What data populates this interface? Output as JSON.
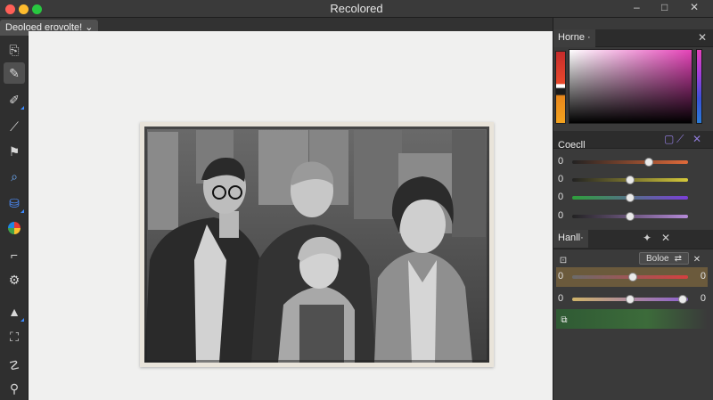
{
  "window": {
    "title": "Recolored",
    "controls": {
      "minimize": "–",
      "maximize": "□",
      "close": "✕"
    }
  },
  "document_tab": {
    "label": "Deoloed erovolte! ⌄"
  },
  "tools": [
    {
      "name": "document-icon",
      "glyph": "⎘"
    },
    {
      "name": "brush-icon",
      "glyph": "✎"
    },
    {
      "name": "eraser-icon",
      "glyph": "✐"
    },
    {
      "name": "dropper-icon",
      "glyph": "⟋"
    },
    {
      "name": "flag-icon",
      "glyph": "⚑"
    },
    {
      "name": "magnify-icon",
      "glyph": "⌕"
    },
    {
      "name": "paint-bucket-icon",
      "glyph": "⛁"
    },
    {
      "name": "color-wheel-icon",
      "glyph": "◕"
    },
    {
      "name": "crop-icon",
      "glyph": "⌐"
    },
    {
      "name": "gear-icon",
      "glyph": "⚙"
    },
    {
      "name": "triangle-icon",
      "glyph": "▲"
    },
    {
      "name": "transform-icon",
      "glyph": "⛶"
    },
    {
      "name": "lasso-icon",
      "glyph": "☡"
    },
    {
      "name": "zoom-icon",
      "glyph": "⚲"
    }
  ],
  "panels": {
    "color": {
      "title": "Horne ·",
      "close": "✕"
    },
    "channels": {
      "title": "Coecll",
      "actions": [
        "▢",
        "⟋",
        "✕"
      ],
      "sliders": [
        {
          "value": "0",
          "level": 0.66,
          "colors": [
            "#222222",
            "#e06a3a"
          ]
        },
        {
          "value": "0",
          "level": 0.5,
          "colors": [
            "#222222",
            "#d4c83a"
          ]
        },
        {
          "value": "0",
          "level": 0.5,
          "colors": [
            "#2ea03b",
            "#7b3fd8"
          ]
        },
        {
          "value": "0",
          "level": 0.5,
          "colors": [
            "#222222",
            "#b58ad8"
          ]
        }
      ]
    },
    "hsl": {
      "title": "Hanll·",
      "actions": [
        "✦",
        "✕"
      ],
      "lock_icon": "⊡",
      "mode_button": "Boloe",
      "mode_extra": "⇄",
      "mode_close": "✕",
      "sliders": [
        {
          "value_left": "0",
          "value_right": "0",
          "level": 0.52,
          "colors": [
            "#6b6b6b",
            "#d44040"
          ]
        },
        {
          "value_left": "0",
          "value_right": "0",
          "level": 0.5,
          "colors": [
            "#d0b46a",
            "#8b5fd0"
          ],
          "level2": 0.95
        }
      ],
      "layer_icon": "⧉"
    }
  }
}
